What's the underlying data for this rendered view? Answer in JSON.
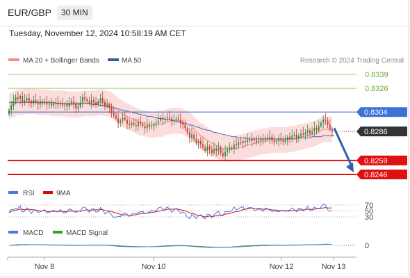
{
  "header": {
    "symbol": "EUR/GBP",
    "timeframe": "30 MIN",
    "datetime": "Tuesday, November 12, 2024 10:58:19 AM CET"
  },
  "legend": {
    "bollinger_label": "MA 20 + Bollinger Bands",
    "ma50_label": "MA 50",
    "copyright": "Research © 2024 Trading Central"
  },
  "colors": {
    "bollinger_fill": "#fbd7d7",
    "ma20": "#e88a8a",
    "ma50": "#4d69a8",
    "resistance": "#9ccf6e",
    "pivot": "#3a72d6",
    "support": "#e01010",
    "last_price_tag": "#333333",
    "arrow": "#2f5fa8",
    "candle_up": "#2c8a3c",
    "candle_down": "#c0392b",
    "rsi": "#4a78d8",
    "rsi_ma": "#cc1010",
    "macd": "#4a78d8",
    "macd_signal": "#3aa020"
  },
  "chart_data": [
    {
      "type": "candlestick",
      "title": "EUR/GBP 30 MIN",
      "x_tick_labels": [
        "Nov 8",
        "Nov 10",
        "Nov 12",
        "Nov 13"
      ],
      "ylim": [
        0.824,
        0.8345
      ],
      "levels": [
        {
          "label": "0.8339",
          "value": 0.8339,
          "kind": "resistance"
        },
        {
          "label": "0.8326",
          "value": 0.8326,
          "kind": "resistance"
        },
        {
          "label": "0.8304",
          "value": 0.8304,
          "kind": "pivot"
        },
        {
          "label": "0.8286",
          "value": 0.8286,
          "kind": "last"
        },
        {
          "label": "0.8259",
          "value": 0.8259,
          "kind": "support"
        },
        {
          "label": "0.8246",
          "value": 0.8246,
          "kind": "support"
        }
      ],
      "close": [
        0.8306,
        0.831,
        0.8314,
        0.8318,
        0.8316,
        0.8319,
        0.8313,
        0.8315,
        0.8317,
        0.8314,
        0.8312,
        0.8315,
        0.8313,
        0.8311,
        0.8314,
        0.8312,
        0.8313,
        0.8311,
        0.8312,
        0.831,
        0.8312,
        0.8313,
        0.8311,
        0.8312,
        0.831,
        0.8311,
        0.8309,
        0.8312,
        0.8314,
        0.8312,
        0.8307,
        0.8309,
        0.8313,
        0.8318,
        0.8316,
        0.8314,
        0.8312,
        0.8315,
        0.8313,
        0.8311,
        0.8314,
        0.8317,
        0.8313,
        0.8309,
        0.8311,
        0.8308,
        0.8303,
        0.8301,
        0.8298,
        0.8294,
        0.8296,
        0.8299,
        0.8297,
        0.8293,
        0.8292,
        0.8294,
        0.8292,
        0.8291,
        0.8295,
        0.8293,
        0.8291,
        0.8289,
        0.8292,
        0.829,
        0.8291,
        0.8293,
        0.8294,
        0.8296,
        0.8298,
        0.8297,
        0.8298,
        0.8299,
        0.8298,
        0.8296,
        0.8297,
        0.8298,
        0.8297,
        0.8294,
        0.8292,
        0.8289,
        0.8285,
        0.828,
        0.8283,
        0.8279,
        0.8275,
        0.8277,
        0.8274,
        0.8271,
        0.8268,
        0.8272,
        0.8269,
        0.8266,
        0.827,
        0.8268,
        0.8271,
        0.8266,
        0.8263,
        0.8267,
        0.8269,
        0.8271,
        0.827,
        0.8274,
        0.8273,
        0.8276,
        0.8275,
        0.8277,
        0.8276,
        0.8278,
        0.8277,
        0.8279,
        0.8278,
        0.8276,
        0.8277,
        0.8279,
        0.8278,
        0.828,
        0.8279,
        0.8281,
        0.8278,
        0.8276,
        0.8277,
        0.8279,
        0.8278,
        0.8276,
        0.8278,
        0.8281,
        0.8279,
        0.8282,
        0.8283,
        0.828,
        0.8282,
        0.8284,
        0.8283,
        0.8285,
        0.8287,
        0.8284,
        0.8286,
        0.8289,
        0.8287,
        0.8291,
        0.8294,
        0.8297,
        0.8296,
        0.8292,
        0.8288,
        0.8286
      ],
      "ma20": [
        0.8309,
        0.831,
        0.8311,
        0.8312,
        0.8313,
        0.8313,
        0.8313,
        0.8314,
        0.8314,
        0.8314,
        0.8314,
        0.8314,
        0.8314,
        0.8313,
        0.8313,
        0.8313,
        0.8313,
        0.8313,
        0.8313,
        0.8312,
        0.8312,
        0.8312,
        0.8312,
        0.8312,
        0.8312,
        0.8312,
        0.8311,
        0.8311,
        0.8311,
        0.8311,
        0.8311,
        0.8311,
        0.8311,
        0.8312,
        0.8312,
        0.8312,
        0.8312,
        0.8312,
        0.8312,
        0.8312,
        0.8313,
        0.8313,
        0.8313,
        0.8312,
        0.8312,
        0.8311,
        0.831,
        0.8309,
        0.8307,
        0.8305,
        0.8304,
        0.8302,
        0.8301,
        0.83,
        0.8299,
        0.8298,
        0.8297,
        0.8296,
        0.8295,
        0.8294,
        0.8294,
        0.8293,
        0.8293,
        0.8292,
        0.8292,
        0.8292,
        0.8292,
        0.8293,
        0.8293,
        0.8293,
        0.8294,
        0.8295,
        0.8295,
        0.8296,
        0.8296,
        0.8296,
        0.8296,
        0.8296,
        0.8295,
        0.8294,
        0.8293,
        0.8292,
        0.829,
        0.8288,
        0.8286,
        0.8284,
        0.8282,
        0.8281,
        0.8279,
        0.8278,
        0.8276,
        0.8275,
        0.8274,
        0.8273,
        0.8272,
        0.8271,
        0.827,
        0.827,
        0.827,
        0.827,
        0.827,
        0.827,
        0.827,
        0.8271,
        0.8271,
        0.8272,
        0.8272,
        0.8273,
        0.8274,
        0.8274,
        0.8275,
        0.8275,
        0.8276,
        0.8276,
        0.8277,
        0.8277,
        0.8277,
        0.8278,
        0.8278,
        0.8278,
        0.8278,
        0.8278,
        0.8278,
        0.8278,
        0.8278,
        0.8278,
        0.8279,
        0.8279,
        0.8279,
        0.828,
        0.828,
        0.8281,
        0.8281,
        0.8282,
        0.8282,
        0.8283,
        0.8283,
        0.8284,
        0.8285,
        0.8286,
        0.8287,
        0.8288,
        0.8288,
        0.8288,
        0.8288,
        0.8288
      ],
      "ma50": [
        0.8313,
        0.8313,
        0.8313,
        0.8313,
        0.8313,
        0.8313,
        0.8313,
        0.8313,
        0.8313,
        0.8313,
        0.8313,
        0.8313,
        0.8313,
        0.8313,
        0.8313,
        0.8313,
        0.8313,
        0.8313,
        0.8313,
        0.8313,
        0.8313,
        0.8312,
        0.8312,
        0.8312,
        0.8312,
        0.8312,
        0.8312,
        0.8312,
        0.8312,
        0.8312,
        0.8312,
        0.8312,
        0.8312,
        0.8312,
        0.8312,
        0.8312,
        0.8312,
        0.8311,
        0.8311,
        0.8311,
        0.8311,
        0.831,
        0.831,
        0.831,
        0.8309,
        0.8309,
        0.8308,
        0.8308,
        0.8307,
        0.8307,
        0.8306,
        0.8306,
        0.8305,
        0.8305,
        0.8304,
        0.8304,
        0.8303,
        0.8303,
        0.8302,
        0.8302,
        0.8301,
        0.8301,
        0.83,
        0.83,
        0.83,
        0.8299,
        0.8299,
        0.8298,
        0.8298,
        0.8298,
        0.8297,
        0.8297,
        0.8297,
        0.8296,
        0.8296,
        0.8295,
        0.8295,
        0.8294,
        0.8294,
        0.8293,
        0.8293,
        0.8292,
        0.8292,
        0.8291,
        0.829,
        0.829,
        0.8289,
        0.8288,
        0.8288,
        0.8287,
        0.8287,
        0.8286,
        0.8285,
        0.8285,
        0.8284,
        0.8284,
        0.8283,
        0.8283,
        0.8282,
        0.8282,
        0.8281,
        0.8281,
        0.8281,
        0.828,
        0.828,
        0.828,
        0.828,
        0.8279,
        0.8279,
        0.8279,
        0.8279,
        0.8279,
        0.8279,
        0.8279,
        0.8279,
        0.8279,
        0.8279,
        0.8279,
        0.8279,
        0.8279,
        0.8279,
        0.8279,
        0.8279,
        0.8279,
        0.8279,
        0.8279,
        0.8279,
        0.8279,
        0.8279,
        0.8279,
        0.828,
        0.828,
        0.828,
        0.828,
        0.828,
        0.828,
        0.8281,
        0.8281,
        0.8281,
        0.8281,
        0.8281,
        0.8282,
        0.8282,
        0.8282,
        0.8282,
        0.8282,
        0.8282
      ],
      "bollinger_width": 0.0012
    },
    {
      "type": "line",
      "title": "RSI",
      "series": [
        {
          "name": "RSI"
        },
        {
          "name": "9MA"
        }
      ],
      "y_tick_labels": [
        "70",
        "50",
        "30"
      ],
      "ylim": [
        20,
        80
      ]
    },
    {
      "type": "line",
      "title": "MACD",
      "series": [
        {
          "name": "MACD"
        },
        {
          "name": "MACD Signal"
        }
      ],
      "y_tick_labels": [
        "0"
      ]
    }
  ],
  "indicators": {
    "rsi": {
      "label": "RSI",
      "ma_label": "9MA"
    },
    "macd": {
      "label": "MACD",
      "signal_label": "MACD Signal"
    }
  }
}
